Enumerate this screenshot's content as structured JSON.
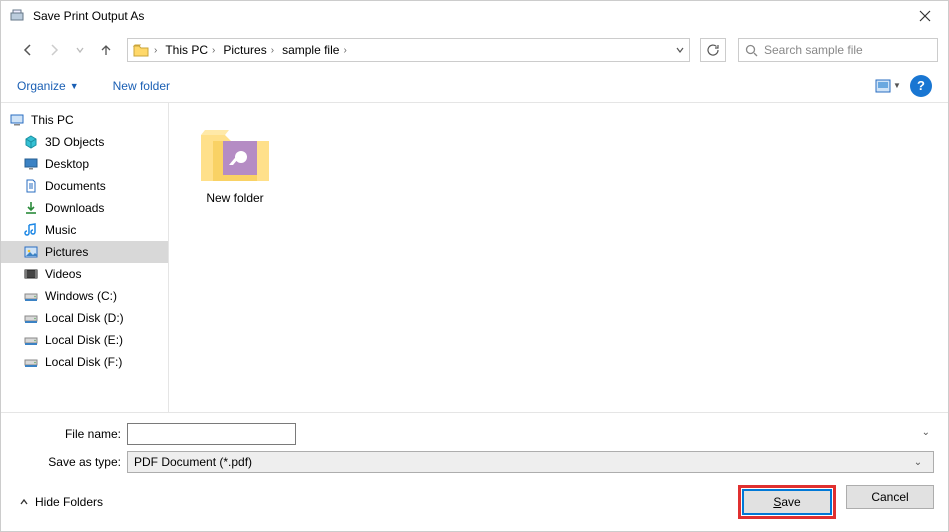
{
  "window": {
    "title": "Save Print Output As"
  },
  "nav": {
    "breadcrumb": [
      "This PC",
      "Pictures",
      "sample file"
    ],
    "search_placeholder": "Search sample file"
  },
  "toolbar": {
    "organize": "Organize",
    "new_folder": "New folder"
  },
  "tree": {
    "root": "This PC",
    "items": [
      {
        "label": "3D Objects",
        "icon": "cube"
      },
      {
        "label": "Desktop",
        "icon": "desktop"
      },
      {
        "label": "Documents",
        "icon": "doc"
      },
      {
        "label": "Downloads",
        "icon": "download"
      },
      {
        "label": "Music",
        "icon": "music"
      },
      {
        "label": "Pictures",
        "icon": "picture",
        "selected": true
      },
      {
        "label": "Videos",
        "icon": "video"
      },
      {
        "label": "Windows (C:)",
        "icon": "drive"
      },
      {
        "label": "Local Disk (D:)",
        "icon": "drive"
      },
      {
        "label": "Local Disk (E:)",
        "icon": "drive"
      },
      {
        "label": "Local Disk (F:)",
        "icon": "drive"
      }
    ]
  },
  "content": {
    "items": [
      {
        "label": "New folder"
      }
    ]
  },
  "form": {
    "filename_label": "File name:",
    "filename_value": "",
    "savetype_label": "Save as type:",
    "savetype_value": "PDF Document (*.pdf)"
  },
  "actions": {
    "hide_folders": "Hide Folders",
    "save": "Save",
    "cancel": "Cancel"
  }
}
